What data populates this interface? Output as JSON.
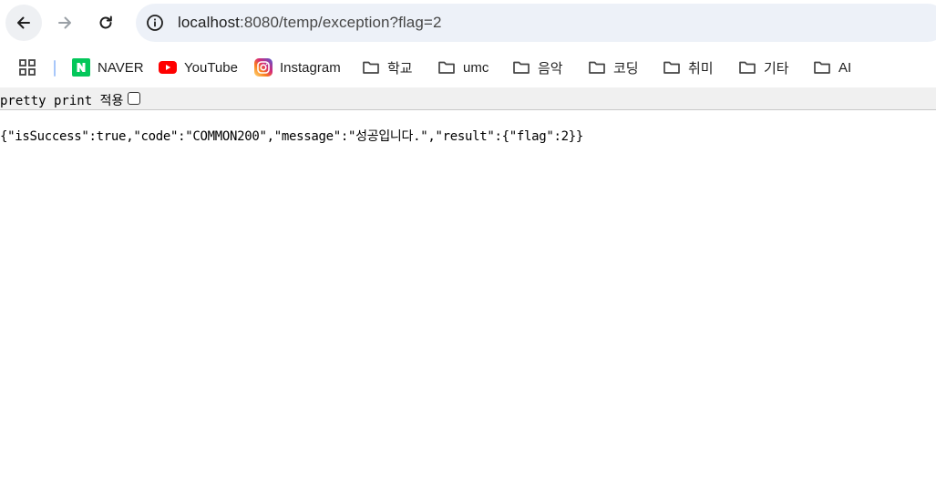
{
  "browser": {
    "url_host": "localhost",
    "url_rest": ":8080/temp/exception?flag=2"
  },
  "bookmarks": [
    {
      "label": "NAVER",
      "icon": "naver-icon"
    },
    {
      "label": "YouTube",
      "icon": "youtube-icon"
    },
    {
      "label": "Instagram",
      "icon": "instagram-icon"
    },
    {
      "label": "학교",
      "icon": "folder-icon"
    },
    {
      "label": "umc",
      "icon": "folder-icon"
    },
    {
      "label": "음악",
      "icon": "folder-icon"
    },
    {
      "label": "코딩",
      "icon": "folder-icon"
    },
    {
      "label": "취미",
      "icon": "folder-icon"
    },
    {
      "label": "기타",
      "icon": "folder-icon"
    },
    {
      "label": "AI",
      "icon": "folder-icon"
    }
  ],
  "json_viewer": {
    "pretty_print_label": "pretty print 적용",
    "pretty_print_checked": false,
    "content": "{\"isSuccess\":true,\"code\":\"COMMON200\",\"message\":\"성공입니다.\",\"result\":{\"flag\":2}}"
  },
  "colors": {
    "omnibox_bg": "#edf1f8",
    "naver_green": "#03c75a",
    "youtube_red": "#ff0000",
    "pretty_bar_bg": "#f0f0f0"
  }
}
